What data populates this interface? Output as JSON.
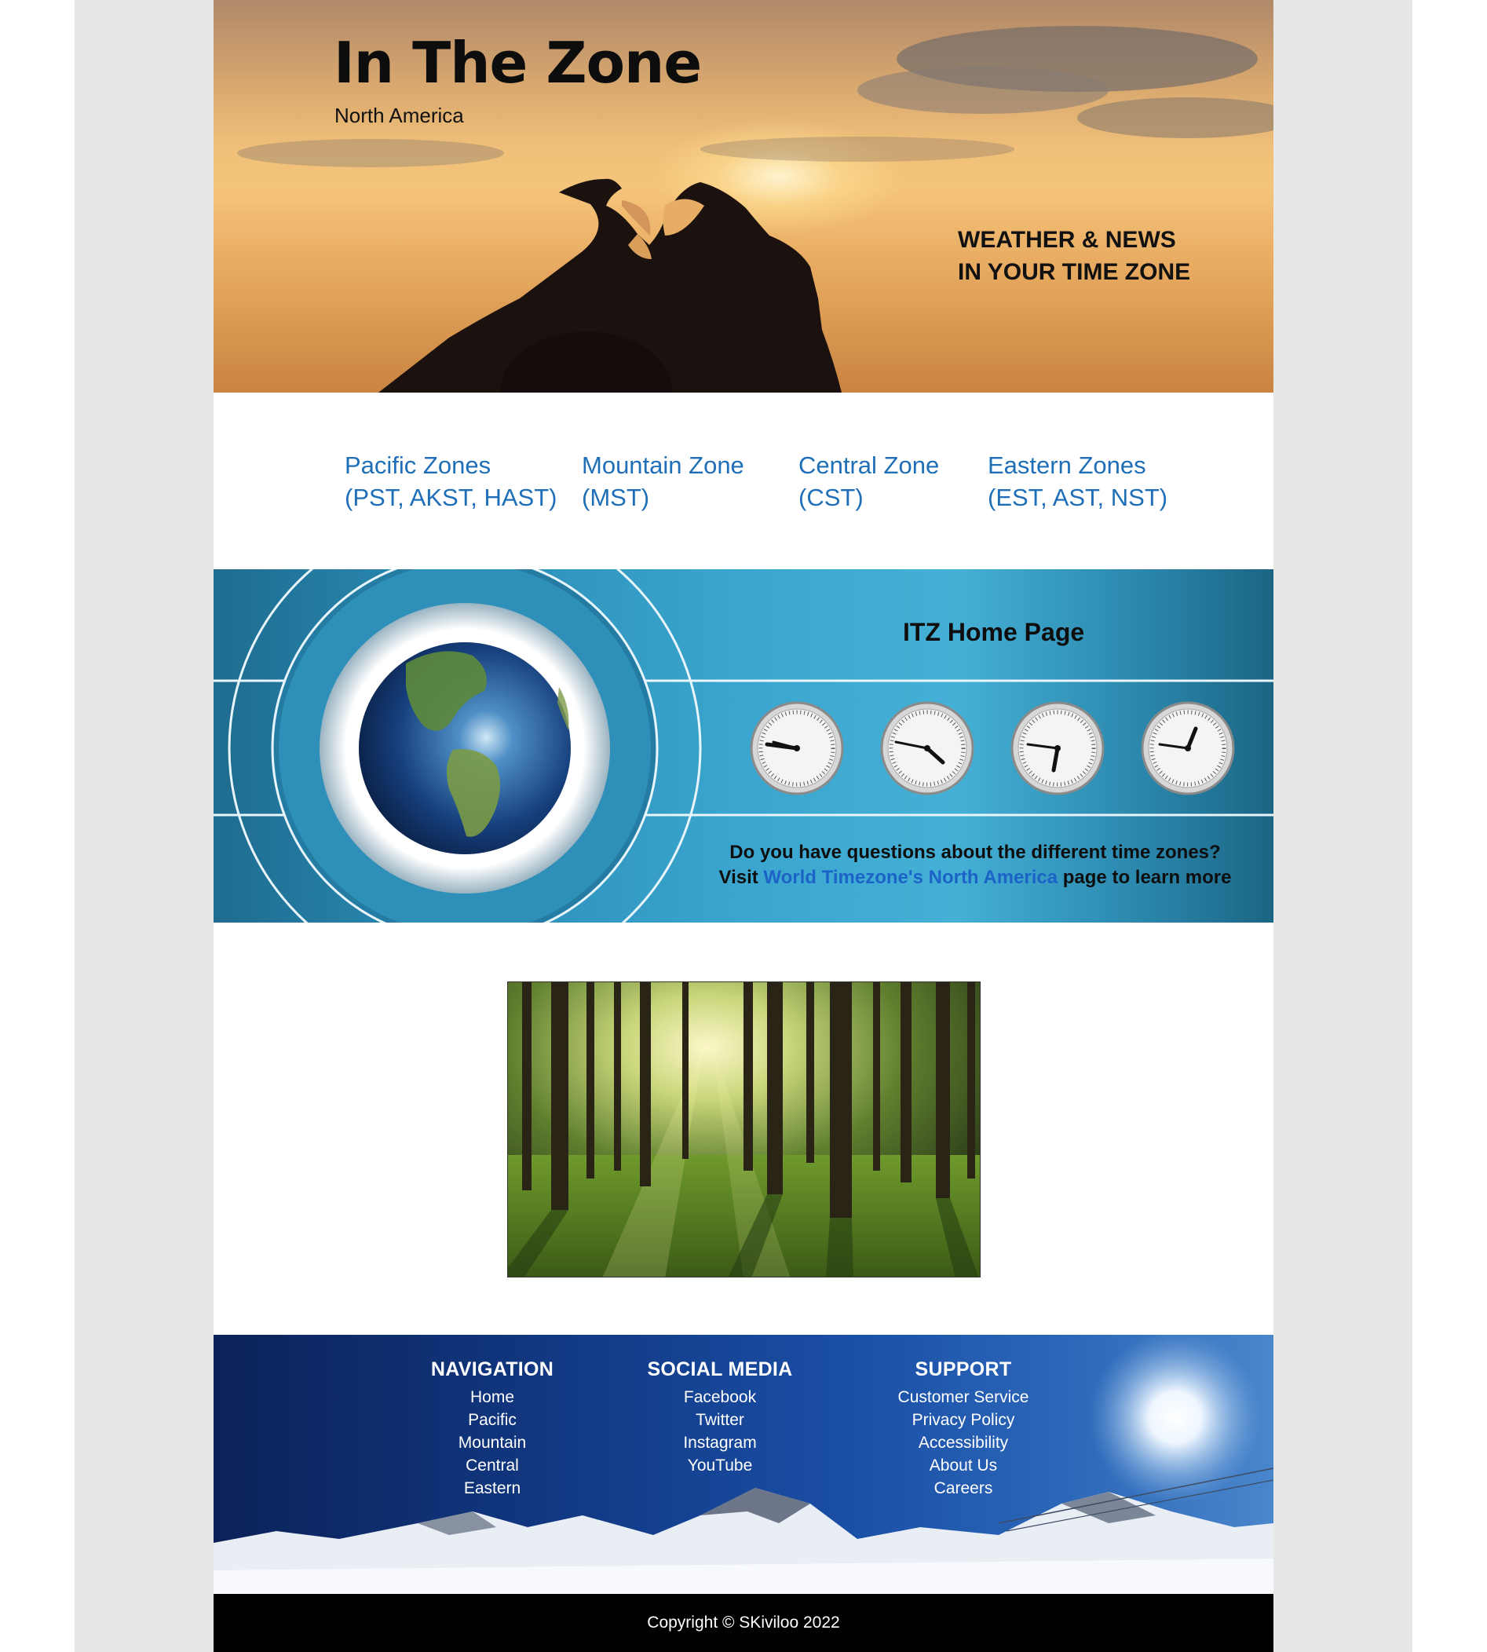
{
  "hero": {
    "title": "In The Zone",
    "subtitle": "North America",
    "tagline_line1": "WEATHER & NEWS",
    "tagline_line2": "IN YOUR TIME ZONE"
  },
  "zones": [
    {
      "name": "Pacific Zones",
      "codes": "(PST, AKST, HAST)"
    },
    {
      "name": "Mountain Zone",
      "codes": "(MST)"
    },
    {
      "name": "Central Zone",
      "codes": "(CST)"
    },
    {
      "name": "Eastern Zones",
      "codes": "(EST, AST, NST)"
    }
  ],
  "itz": {
    "title": "ITZ Home Page",
    "question": "Do you have questions about the different time zones?",
    "visit": "Visit",
    "link_text": "World Timezone's North America",
    "after_link": "page to learn more"
  },
  "footer": {
    "columns": [
      {
        "heading": "NAVIGATION",
        "links": [
          "Home",
          "Pacific",
          "Mountain",
          "Central",
          "Eastern"
        ]
      },
      {
        "heading": "SOCIAL MEDIA",
        "links": [
          "Facebook",
          "Twitter",
          "Instagram",
          "YouTube"
        ]
      },
      {
        "heading": "SUPPORT",
        "links": [
          "Customer Service",
          "Privacy Policy",
          "Accessibility",
          "About Us",
          "Careers"
        ]
      }
    ],
    "copyright": "Copyright © SKiviloo 2022"
  },
  "colors": {
    "link": "#1f6fb8",
    "itz_link": "#1c63c7",
    "footer_bar": "#000000",
    "side_gutter": "#e6e8e6"
  }
}
